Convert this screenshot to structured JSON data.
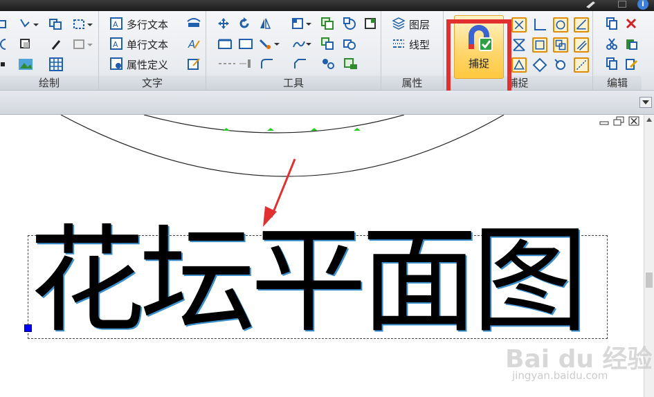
{
  "ribbon": {
    "groups": {
      "draw": "绘制",
      "text": "文字",
      "tools": "工具",
      "properties": "属性",
      "snap": "捕捉",
      "edit": "编辑"
    },
    "text_buttons": {
      "mtext": "多行文本",
      "dtext": "单行文本",
      "attdef": "属性定义"
    },
    "property_buttons": {
      "layer": "图层",
      "linetype": "线型"
    },
    "capture_button": "捕捉"
  },
  "drawing": {
    "title_text": "花坛平面图"
  },
  "watermark": {
    "brand": "Bai du 经验",
    "url": "jingyan.baidu.com"
  },
  "colors": {
    "highlight": "#e23030",
    "arrow": "#e23030",
    "grip": "#0000ff"
  }
}
